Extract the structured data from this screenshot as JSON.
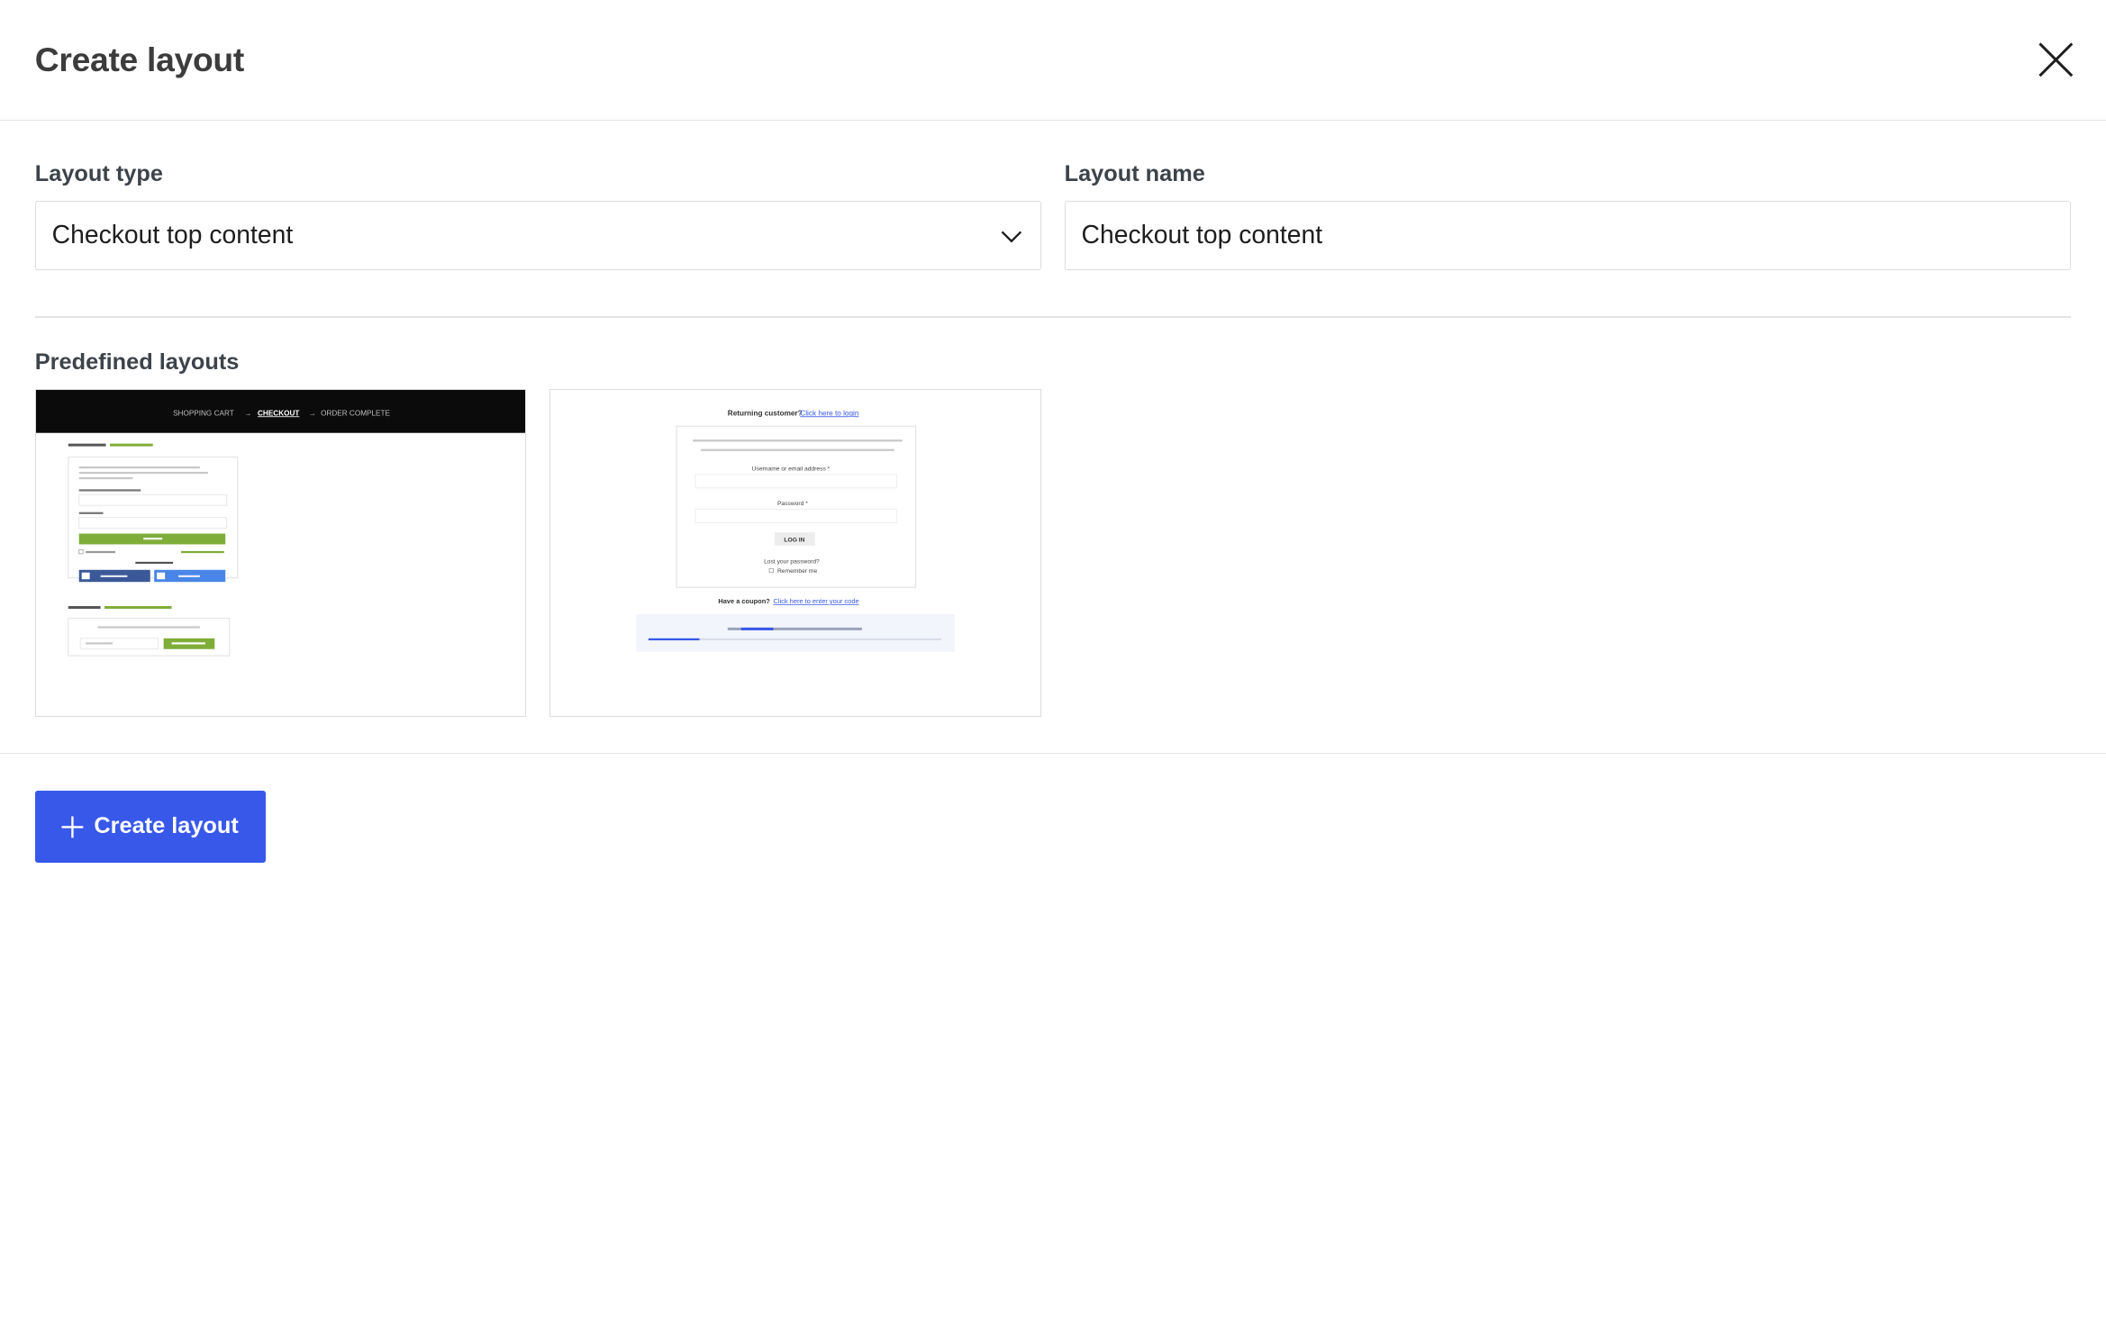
{
  "header": {
    "title": "Create layout",
    "close_icon": "close-icon"
  },
  "form": {
    "layout_type": {
      "label": "Layout type",
      "selected": "Checkout top content",
      "icon": "chevron-down-icon"
    },
    "layout_name": {
      "label": "Layout name",
      "value": "Checkout top content"
    }
  },
  "predefined": {
    "label": "Predefined layouts",
    "items": [
      {
        "nav": [
          "SHOPPING CART",
          "→",
          "CHECKOUT",
          "→",
          "ORDER COMPLETE"
        ]
      },
      {
        "returning": "Returning customer?",
        "login_link": "Click here to login",
        "username_label": "Username or email address *",
        "password_label": "Password *",
        "login_button": "LOG IN",
        "lost_password": "Lost your password?",
        "remember": "Remember me",
        "coupon": "Have a coupon?",
        "coupon_link": "Click here to enter your code"
      }
    ]
  },
  "footer": {
    "create_button": "Create layout",
    "create_icon": "plus-icon"
  },
  "colors": {
    "primary": "#3858e9",
    "title": "#3c3c3c",
    "border": "#dcdcde",
    "preview_green": "#7fad39",
    "preview_dark": "#0b0b0b"
  }
}
